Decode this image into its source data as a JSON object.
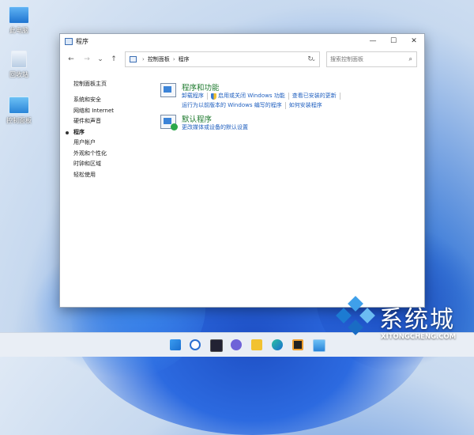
{
  "desktop": {
    "icons": [
      {
        "label": "此电脑",
        "icon": "computer-icon"
      },
      {
        "label": "回收站",
        "icon": "recycle-bin-icon"
      },
      {
        "label": "控制面板",
        "icon": "control-panel-icon"
      }
    ]
  },
  "window": {
    "title": "程序",
    "controls": {
      "minimize": "—",
      "maximize": "☐",
      "close": "✕"
    }
  },
  "navbar": {
    "back": "←",
    "forward": "→",
    "recent": "⌄",
    "up": "↑",
    "breadcrumb": [
      "控制面板",
      "程序"
    ],
    "breadcrumb_sep": "›",
    "dropdown": "⌄",
    "refresh": "↻",
    "search_placeholder": "搜索控制面板",
    "search_icon": "⌕"
  },
  "sidebar": {
    "home": "控制面板主页",
    "items": [
      "系统和安全",
      "网络和 Internet",
      "硬件和声音",
      "程序",
      "用户帐户",
      "外观和个性化",
      "时钟和区域",
      "轻松使用"
    ],
    "active": "程序"
  },
  "categories": [
    {
      "title": "程序和功能",
      "icon": "programs-features-icon",
      "links_row1": [
        "卸载程序",
        "启用或关闭 Windows 功能",
        "查看已安装的更新"
      ],
      "links_row2": [
        "运行为以前版本的 Windows 编写的程序",
        "如何安装程序"
      ]
    },
    {
      "title": "默认程序",
      "icon": "default-programs-icon",
      "links_row1": [
        "更改媒体或设备的默认设置"
      ]
    }
  ],
  "taskbar": {
    "icons": [
      "start-icon",
      "search-icon",
      "task-view-icon",
      "chat-icon",
      "file-explorer-icon",
      "edge-icon",
      "store-icon",
      "control-panel-icon"
    ]
  },
  "watermark": {
    "brand": "系统城",
    "url": "XITONGCHENG.COM"
  }
}
